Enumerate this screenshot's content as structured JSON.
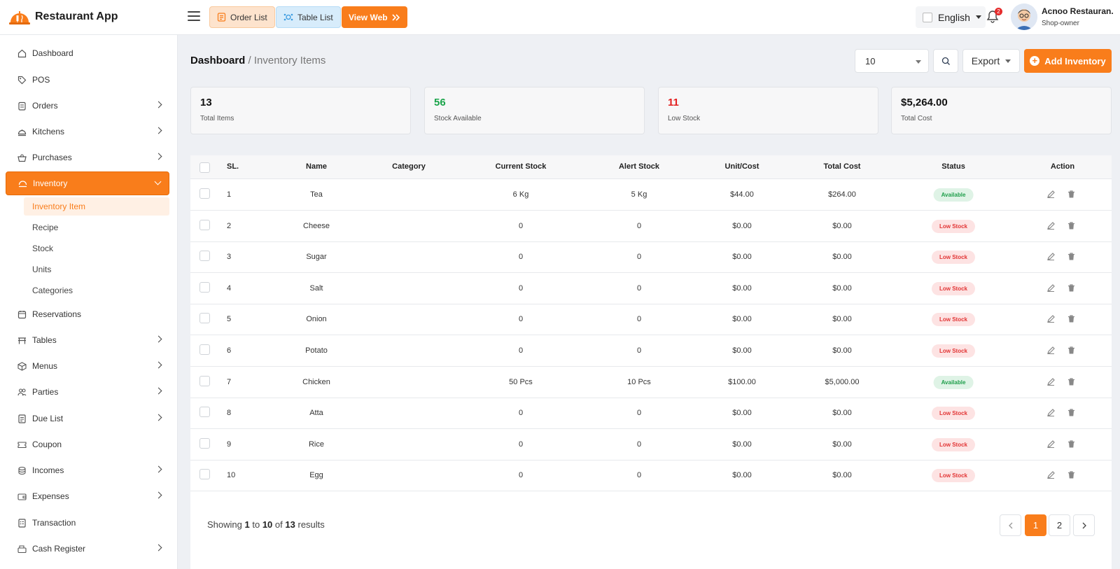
{
  "app": {
    "name": "Restaurant App"
  },
  "toolbar": {
    "order_list": "Order List",
    "table_list": "Table List",
    "view_web": "View Web"
  },
  "language": {
    "selected": "English"
  },
  "notifications": {
    "count": "2"
  },
  "user": {
    "name": "Acnoo Restauran.",
    "role": "Shop-owner"
  },
  "sidebar": {
    "items": [
      {
        "label": "Dashboard"
      },
      {
        "label": "POS"
      },
      {
        "label": "Orders"
      },
      {
        "label": "Kitchens"
      },
      {
        "label": "Purchases"
      },
      {
        "label": "Inventory"
      },
      {
        "label": "Reservations"
      },
      {
        "label": "Tables"
      },
      {
        "label": "Menus"
      },
      {
        "label": "Parties"
      },
      {
        "label": "Due List"
      },
      {
        "label": "Coupon"
      },
      {
        "label": "Incomes"
      },
      {
        "label": "Expenses"
      },
      {
        "label": "Transaction"
      },
      {
        "label": "Cash Register"
      }
    ],
    "inventory_sub": [
      {
        "label": "Inventory Item"
      },
      {
        "label": "Recipe"
      },
      {
        "label": "Stock"
      },
      {
        "label": "Units"
      },
      {
        "label": "Categories"
      }
    ]
  },
  "breadcrumb": {
    "root": "Dashboard",
    "current": "/ Inventory Items"
  },
  "controls": {
    "per_page": "10",
    "export": "Export",
    "add": "Add Inventory"
  },
  "stats": [
    {
      "value": "13",
      "label": "Total Items"
    },
    {
      "value": "56",
      "label": "Stock Available"
    },
    {
      "value": "11",
      "label": "Low Stock"
    },
    {
      "value": "$5,264.00",
      "label": "Total Cost"
    }
  ],
  "table": {
    "headers": {
      "sl": "SL.",
      "name": "Name",
      "category": "Category",
      "current": "Current Stock",
      "alert": "Alert Stock",
      "unit": "Unit/Cost",
      "total": "Total Cost",
      "status": "Status",
      "action": "Action"
    },
    "rows": [
      {
        "sl": "1",
        "name": "Tea",
        "category": "",
        "current": "6 Kg",
        "alert": "5 Kg",
        "unit": "$44.00",
        "total": "$264.00",
        "status": "Available"
      },
      {
        "sl": "2",
        "name": "Cheese",
        "category": "",
        "current": "0",
        "alert": "0",
        "unit": "$0.00",
        "total": "$0.00",
        "status": "Low Stock"
      },
      {
        "sl": "3",
        "name": "Sugar",
        "category": "",
        "current": "0",
        "alert": "0",
        "unit": "$0.00",
        "total": "$0.00",
        "status": "Low Stock"
      },
      {
        "sl": "4",
        "name": "Salt",
        "category": "",
        "current": "0",
        "alert": "0",
        "unit": "$0.00",
        "total": "$0.00",
        "status": "Low Stock"
      },
      {
        "sl": "5",
        "name": "Onion",
        "category": "",
        "current": "0",
        "alert": "0",
        "unit": "$0.00",
        "total": "$0.00",
        "status": "Low Stock"
      },
      {
        "sl": "6",
        "name": "Potato",
        "category": "",
        "current": "0",
        "alert": "0",
        "unit": "$0.00",
        "total": "$0.00",
        "status": "Low Stock"
      },
      {
        "sl": "7",
        "name": "Chicken",
        "category": "",
        "current": "50 Pcs",
        "alert": "10 Pcs",
        "unit": "$100.00",
        "total": "$5,000.00",
        "status": "Available"
      },
      {
        "sl": "8",
        "name": "Atta",
        "category": "",
        "current": "0",
        "alert": "0",
        "unit": "$0.00",
        "total": "$0.00",
        "status": "Low Stock"
      },
      {
        "sl": "9",
        "name": "Rice",
        "category": "",
        "current": "0",
        "alert": "0",
        "unit": "$0.00",
        "total": "$0.00",
        "status": "Low Stock"
      },
      {
        "sl": "10",
        "name": "Egg",
        "category": "",
        "current": "0",
        "alert": "0",
        "unit": "$0.00",
        "total": "$0.00",
        "status": "Low Stock"
      }
    ]
  },
  "pagination": {
    "prefix": "Showing",
    "from": "1",
    "to_word": "to",
    "to": "10",
    "of_word": "of",
    "total": "13",
    "suffix": "results",
    "pages": [
      "1",
      "2"
    ]
  },
  "colors": {
    "accent": "#f97d1b",
    "available": "#1e9e4a",
    "low": "#e23535"
  }
}
